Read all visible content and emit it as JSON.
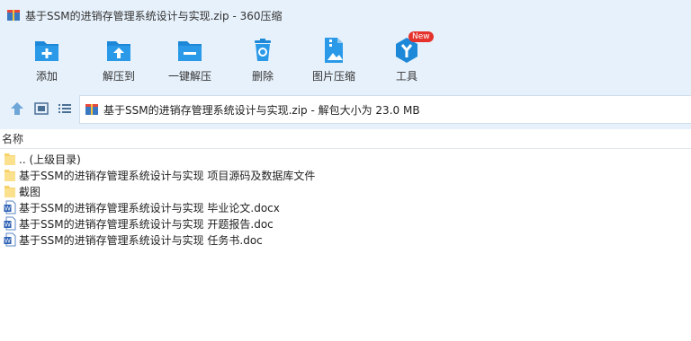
{
  "window": {
    "title": "基于SSM的进销存管理系统设计与实现.zip - 360压缩"
  },
  "toolbar": {
    "items": [
      {
        "label": "添加",
        "icon": "add-folder-icon"
      },
      {
        "label": "解压到",
        "icon": "extract-to-icon"
      },
      {
        "label": "一键解压",
        "icon": "one-click-extract-icon"
      },
      {
        "label": "删除",
        "icon": "trash-icon"
      },
      {
        "label": "图片压缩",
        "icon": "image-compress-icon"
      },
      {
        "label": "工具",
        "icon": "tools-icon",
        "badge": "New"
      }
    ]
  },
  "address": {
    "path": "基于SSM的进销存管理系统设计与实现.zip - 解包大小为 23.0 MB"
  },
  "list": {
    "header": "名称",
    "rows": [
      {
        "name": ".. (上级目录)",
        "type": "folder"
      },
      {
        "name": "基于SSM的进销存管理系统设计与实现 项目源码及数据库文件",
        "type": "folder"
      },
      {
        "name": "截图",
        "type": "folder"
      },
      {
        "name": "基于SSM的进销存管理系统设计与实现 毕业论文.docx",
        "type": "doc"
      },
      {
        "name": "基于SSM的进销存管理系统设计与实现 开题报告.doc",
        "type": "doc"
      },
      {
        "name": "基于SSM的进销存管理系统设计与实现 任务书.doc",
        "type": "doc"
      }
    ]
  },
  "colors": {
    "chrome_bg": "#e7f1fb",
    "icon_blue": "#1e88d8",
    "folder_yellow": "#f7d26a",
    "badge_red": "#e5322d"
  }
}
